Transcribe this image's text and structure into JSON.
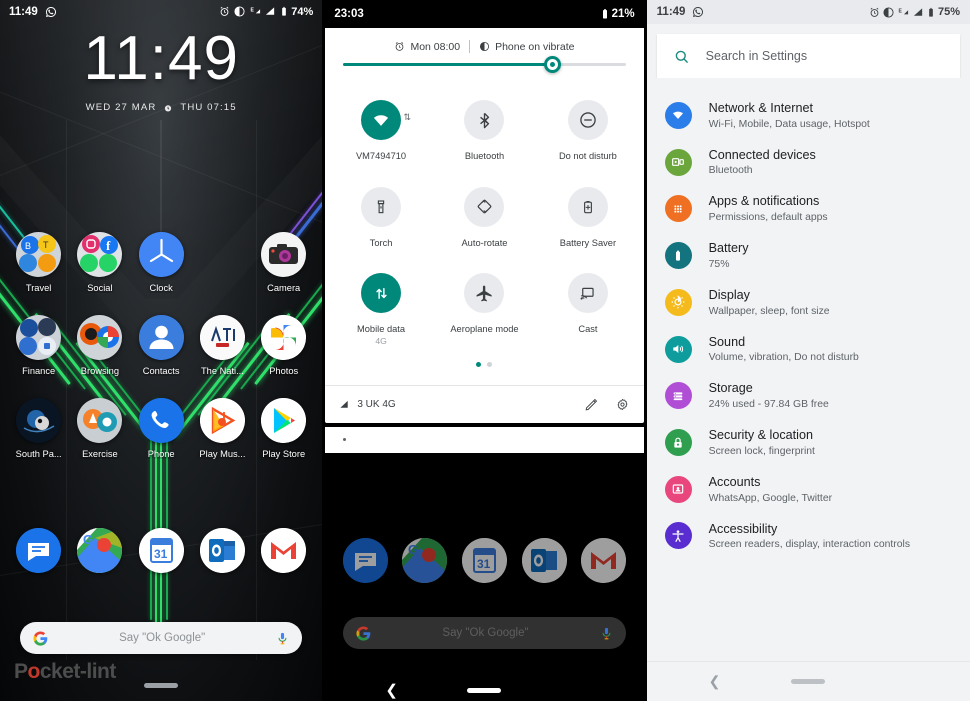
{
  "panel_lockscreen": {
    "status_bar": {
      "time": "11:49",
      "left_icons": [
        "whatsapp-icon"
      ],
      "right_icons": [
        "alarm-icon",
        "do-not-disturb-icon",
        "edge-network-icon",
        "signal-icon",
        "battery-icon"
      ],
      "battery": "74%"
    },
    "clock": "11:49",
    "date": "WED 27 MAR",
    "alarm": "THU 07:15",
    "rows": [
      [
        {
          "label": "Travel",
          "icon": "folder-travel-icon"
        },
        {
          "label": "Social",
          "icon": "folder-social-icon"
        },
        {
          "label": "Clock",
          "icon": "clock-icon"
        },
        {
          "label": "",
          "icon": "spacer"
        },
        {
          "label": "Camera",
          "icon": "camera-icon"
        }
      ],
      [
        {
          "label": "Finance",
          "icon": "folder-finance-icon"
        },
        {
          "label": "Browsing",
          "icon": "folder-browsing-icon"
        },
        {
          "label": "Contacts",
          "icon": "contacts-icon"
        },
        {
          "label": "The Nati...",
          "icon": "the-national-icon"
        },
        {
          "label": "Photos",
          "icon": "google-photos-icon"
        }
      ],
      [
        {
          "label": "South Pa...",
          "icon": "south-park-icon"
        },
        {
          "label": "Exercise",
          "icon": "folder-exercise-icon"
        },
        {
          "label": "Phone",
          "icon": "phone-icon"
        },
        {
          "label": "Play Mus...",
          "icon": "play-music-icon"
        },
        {
          "label": "Play Store",
          "icon": "play-store-icon"
        }
      ]
    ],
    "dock": [
      {
        "label": "Messages",
        "icon": "messages-icon"
      },
      {
        "label": "Maps",
        "icon": "google-maps-icon"
      },
      {
        "label": "Calendar",
        "icon": "google-calendar-icon"
      },
      {
        "label": "Outlook",
        "icon": "outlook-icon"
      },
      {
        "label": "Gmail",
        "icon": "gmail-icon"
      }
    ],
    "search_placeholder": "Say \"Ok Google\"",
    "watermark": "Pocket-lint"
  },
  "panel_quicksettings": {
    "status_bar": {
      "time": "23:03",
      "battery": "21%"
    },
    "header": {
      "alarm": "Mon 08:00",
      "ringer": "Phone on vibrate"
    },
    "brightness_percent": 74,
    "tiles": [
      [
        {
          "label": "VM7494710",
          "sub": "",
          "icon": "wifi-icon",
          "active": true
        },
        {
          "label": "Bluetooth",
          "sub": "",
          "icon": "bluetooth-icon",
          "active": false
        },
        {
          "label": "Do not disturb",
          "sub": "",
          "icon": "do-not-disturb-icon",
          "active": false
        }
      ],
      [
        {
          "label": "Torch",
          "sub": "",
          "icon": "torch-icon",
          "active": false
        },
        {
          "label": "Auto-rotate",
          "sub": "",
          "icon": "auto-rotate-icon",
          "active": false
        },
        {
          "label": "Battery Saver",
          "sub": "",
          "icon": "battery-saver-icon",
          "active": false
        }
      ],
      [
        {
          "label": "Mobile data",
          "sub": "4G",
          "icon": "mobile-data-icon",
          "active": true
        },
        {
          "label": "Aeroplane mode",
          "sub": "",
          "icon": "aeroplane-icon",
          "active": false
        },
        {
          "label": "Cast",
          "sub": "",
          "icon": "cast-icon",
          "active": false
        }
      ]
    ],
    "page_count": 2,
    "page_active": 1,
    "footer": {
      "carrier": "3 UK 4G",
      "edit_icon": "pencil-icon",
      "settings_icon": "gear-icon"
    },
    "dock": [
      {
        "label": "Messages",
        "icon": "messages-icon"
      },
      {
        "label": "Maps",
        "icon": "google-maps-icon"
      },
      {
        "label": "Calendar",
        "icon": "google-calendar-icon"
      },
      {
        "label": "Outlook",
        "icon": "outlook-icon"
      },
      {
        "label": "Gmail",
        "icon": "gmail-icon"
      }
    ],
    "search_placeholder": "Say \"Ok Google\""
  },
  "panel_settings": {
    "status_bar": {
      "time": "11:49",
      "left_icons": [
        "whatsapp-icon"
      ],
      "right_icons": [
        "alarm-icon",
        "do-not-disturb-icon",
        "edge-network-icon",
        "signal-icon",
        "battery-icon"
      ],
      "battery": "75%"
    },
    "search_placeholder": "Search in Settings",
    "items": [
      {
        "title": "Network & Internet",
        "desc": "Wi-Fi, Mobile, Data usage, Hotspot",
        "icon": "wifi-icon",
        "color": "#2b7de9"
      },
      {
        "title": "Connected devices",
        "desc": "Bluetooth",
        "icon": "connected-devices-icon",
        "color": "#6aa63b"
      },
      {
        "title": "Apps & notifications",
        "desc": "Permissions, default apps",
        "icon": "apps-grid-icon",
        "color": "#f07023"
      },
      {
        "title": "Battery",
        "desc": "75%",
        "icon": "battery-icon",
        "color": "#13737e"
      },
      {
        "title": "Display",
        "desc": "Wallpaper, sleep, font size",
        "icon": "brightness-icon",
        "color": "#f5bb1d"
      },
      {
        "title": "Sound",
        "desc": "Volume, vibration, Do not disturb",
        "icon": "speaker-icon",
        "color": "#0f9c9c"
      },
      {
        "title": "Storage",
        "desc": "24% used - 97.84 GB free",
        "icon": "storage-icon",
        "color": "#b04fd6"
      },
      {
        "title": "Security & location",
        "desc": "Screen lock, fingerprint",
        "icon": "lock-icon",
        "color": "#2f9e4f"
      },
      {
        "title": "Accounts",
        "desc": "WhatsApp, Google, Twitter",
        "icon": "account-card-icon",
        "color": "#e8467c"
      },
      {
        "title": "Accessibility",
        "desc": "Screen readers, display, interaction controls",
        "icon": "accessibility-icon",
        "color": "#5a2dd1"
      }
    ]
  }
}
